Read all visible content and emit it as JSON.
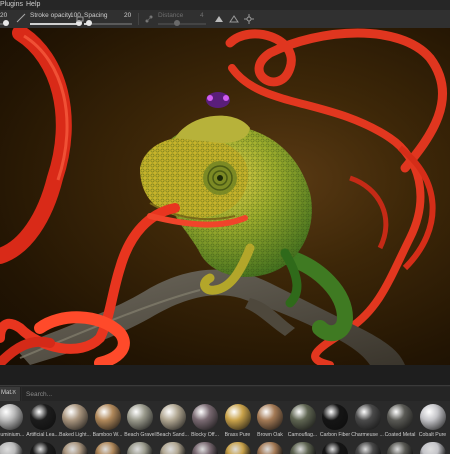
{
  "menubar": {
    "items": [
      "Plugins",
      "Help"
    ]
  },
  "toolbar": {
    "first_value": "20",
    "stroke_opacity_label": "Stroke opacity",
    "stroke_opacity_value": "100",
    "spacing_label": "Spacing",
    "spacing_value": "20",
    "distance_label": "Distance",
    "distance_value": "4"
  },
  "shelf": {
    "tab_label": "Mat...",
    "search_placeholder": "Search...",
    "materials": [
      {
        "label": "Aluminium...",
        "color": "#b9b9b9"
      },
      {
        "label": "Artificial Lea...",
        "color": "#1c1c1c"
      },
      {
        "label": "Baked Light...",
        "color": "#a9957e"
      },
      {
        "label": "Bamboo W...",
        "color": "#b0885a"
      },
      {
        "label": "Beach Gravel",
        "color": "#9a9a8c"
      },
      {
        "label": "Beach Sand...",
        "color": "#b1a792"
      },
      {
        "label": "Blocky Off...",
        "color": "#7a6a72"
      },
      {
        "label": "Brass Pure",
        "color": "#c9a24a"
      },
      {
        "label": "Brown Oak",
        "color": "#a47a55"
      },
      {
        "label": "Camouflag...",
        "color": "#5f6552"
      },
      {
        "label": "Carbon Fiber",
        "color": "#151515"
      },
      {
        "label": "Charmeuse ...",
        "color": "#4a4a4a"
      },
      {
        "label": "Coated Metal",
        "color": "#5a5a55"
      },
      {
        "label": "Cobalt Pure",
        "color": "#c4c4c8"
      }
    ]
  },
  "colors": {
    "accent": "#d8d8d8",
    "ribbon": "#e8321e",
    "chameleon": "#c9b22a"
  }
}
